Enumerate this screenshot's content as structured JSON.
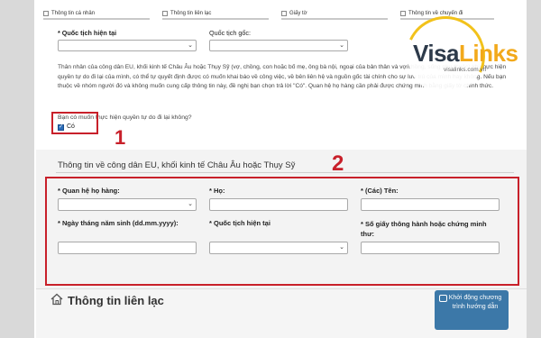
{
  "steps": [
    {
      "label": "Thông tin cá nhân"
    },
    {
      "label": "Thông tin liên lạc"
    },
    {
      "label": "Giấy tờ"
    },
    {
      "label": "Thông tin về chuyến đi"
    }
  ],
  "form_top": {
    "current_nationality_label": "* Quốc tịch hiện tại",
    "origin_nationality_label": "Quốc tịch gốc:",
    "paragraph": "Thân nhân của công dân EU, khối kinh tế Châu Âu hoặc Thụy Sỹ (vợ, chồng, con hoặc bố mẹ, ông bà nội, ngoại của bản thân và vợ/chồng, sống phụ thuộc) khi thực hiện quyền tự do đi lại của mình, có thể tự quyết định được có muốn khai báo về công việc, về bên liên hệ và nguồn gốc tài chính cho sự lưu trú của mình hay không. Nếu bạn thuộc về nhóm người đó và không muốn cung cấp thông tin này, đề nghị bạn chọn trả lời \"Có\". Quan hệ họ hàng cần phải được chứng minh bằng giấy tờ chính thức.",
    "question": "Bạn có muốn thực hiện quyền tự do đi lại không?",
    "checkbox_label": "Có",
    "checkbox_checked": true,
    "callout_1": "1"
  },
  "eu_section": {
    "title": "Thông tin về công dân EU, khối kinh tế Châu Âu hoặc Thụy Sỹ",
    "callout_2": "2",
    "relationship_label": "* Quan hệ họ hàng:",
    "surname_label": "* Họ:",
    "given_names_label": "* (Các) Tên:",
    "dob_label": "* Ngày tháng năm sinh (dd.mm.yyyy):",
    "nationality_label": "* Quốc tịch hiện tại",
    "passport_label": "* Số giấy thông hành hoặc chứng minh thư:"
  },
  "contact": {
    "title": "Thông tin liên lạc",
    "launch_button": "Khởi động chương trình hướng dẫn"
  },
  "logo": {
    "word_visa": "Visa",
    "word_links": "Links",
    "site": "visalinks.com.vn"
  },
  "colors": {
    "callout_red": "#c8202a",
    "button_blue": "#3c78a8",
    "logo_yellow": "#f2c21b"
  },
  "icons": [
    "house-icon",
    "chat-icon",
    "chevron-down-icon",
    "checkmark-icon"
  ]
}
